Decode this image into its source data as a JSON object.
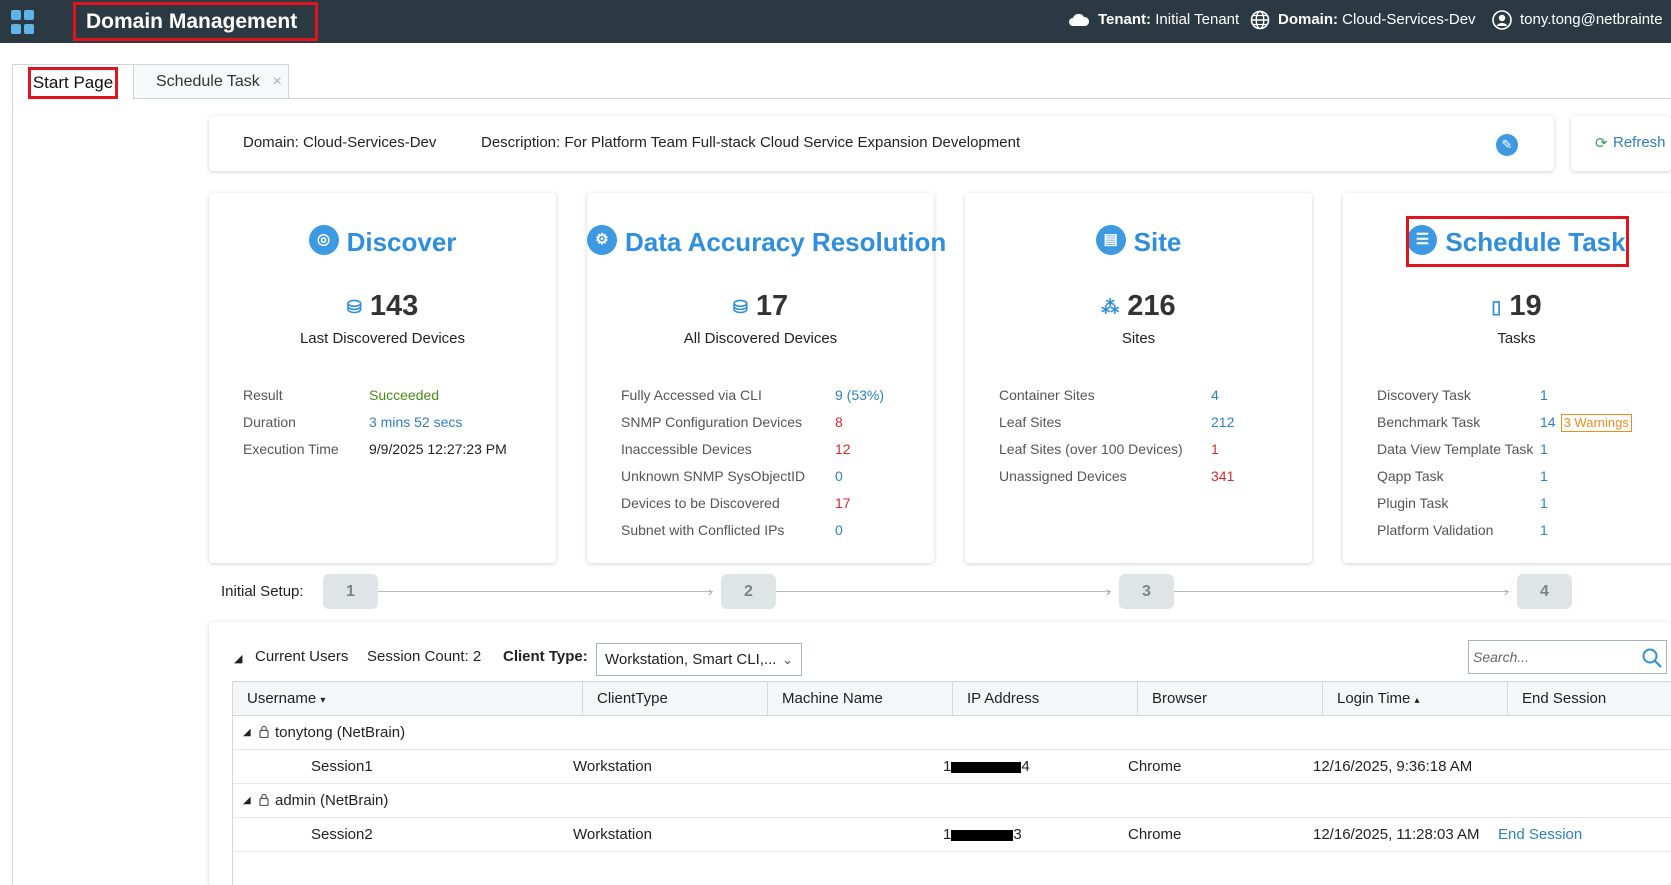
{
  "header": {
    "title": "Domain Management",
    "tenant_label": "Tenant:",
    "tenant_value": "Initial Tenant",
    "domain_label": "Domain:",
    "domain_value": "Cloud-Services-Dev",
    "user": "tony.tong@netbrainte"
  },
  "tabs": [
    {
      "label": "Start Page"
    },
    {
      "label": "Schedule Task",
      "close": "×"
    }
  ],
  "domain_info": {
    "domain": "Domain:  Cloud-Services-Dev",
    "description": "Description:  For Platform Team Full-stack Cloud Service Expansion Development",
    "refresh": "Refresh"
  },
  "cards": {
    "discover": {
      "title": "Discover",
      "count": "143",
      "subtitle": "Last Discovered Devices",
      "rows": [
        {
          "label": "Result",
          "value": "Succeeded"
        },
        {
          "label": "Duration",
          "value": "3 mins 52 secs"
        },
        {
          "label": "Execution Time",
          "value": "9/9/2025 12:27:23 PM"
        }
      ]
    },
    "dar": {
      "title": "Data Accuracy Resolution",
      "count": "17",
      "subtitle": "All Discovered Devices",
      "rows": [
        {
          "label": "Fully Accessed via CLI",
          "value": "9 (53%)"
        },
        {
          "label": "SNMP Configuration Devices",
          "value": "8"
        },
        {
          "label": "Inaccessible Devices",
          "value": "12"
        },
        {
          "label": "Unknown SNMP SysObjectID",
          "value": "0"
        },
        {
          "label": "Devices to be Discovered",
          "value": "17"
        },
        {
          "label": "Subnet with Conflicted IPs",
          "value": "0"
        }
      ]
    },
    "site": {
      "title": "Site",
      "count": "216",
      "subtitle": "Sites",
      "rows": [
        {
          "label": "Container Sites",
          "value": "4"
        },
        {
          "label": "Leaf Sites",
          "value": "212"
        },
        {
          "label": "Leaf Sites (over 100 Devices)",
          "value": "1"
        },
        {
          "label": "Unassigned Devices",
          "value": "341"
        }
      ]
    },
    "schedule": {
      "title": "Schedule Task",
      "count": "19",
      "subtitle": "Tasks",
      "warnings": "3 Warnings",
      "rows": [
        {
          "label": "Discovery Task",
          "value": "1"
        },
        {
          "label": "Benchmark Task",
          "value": "14"
        },
        {
          "label": "Data View Template Task",
          "value": "1"
        },
        {
          "label": "Qapp Task",
          "value": "1"
        },
        {
          "label": "Plugin Task",
          "value": "1"
        },
        {
          "label": "Platform Validation",
          "value": "1"
        }
      ]
    }
  },
  "setup": {
    "label": "Initial Setup:",
    "steps": [
      "1",
      "2",
      "3",
      "4"
    ]
  },
  "users": {
    "section_label": "Current Users",
    "session_count": "Session Count: 2",
    "client_type_label": "Client Type:",
    "client_type_value": "Workstation, Smart CLI,...",
    "search_placeholder": "Search...",
    "columns": [
      "Username",
      "ClientType",
      "Machine Name",
      "IP Address",
      "Browser",
      "Login Time",
      "End Session"
    ],
    "groups": [
      {
        "name": "tonytong (NetBrain)",
        "sessions": [
          {
            "session": "Session1",
            "client": "Workstation",
            "machine": "",
            "ip_start": "1",
            "ip_end": "4",
            "browser": "Chrome",
            "login": "12/16/2025, 9:36:18 AM",
            "end": ""
          }
        ]
      },
      {
        "name": "admin (NetBrain)",
        "sessions": [
          {
            "session": "Session2",
            "client": "Workstation",
            "machine": "",
            "ip_start": "1",
            "ip_end": "3",
            "browser": "Chrome",
            "login": "12/16/2025, 11:28:03 AM",
            "end": "End Session"
          }
        ]
      }
    ]
  },
  "colors": {
    "topbar": "#2b3a42",
    "accent": "#2f8fdc",
    "link": "#2f7fc2",
    "danger": "#d9282e",
    "success": "#4a8a1a",
    "warning": "#f08c1e",
    "highlight": "#e0141e"
  }
}
